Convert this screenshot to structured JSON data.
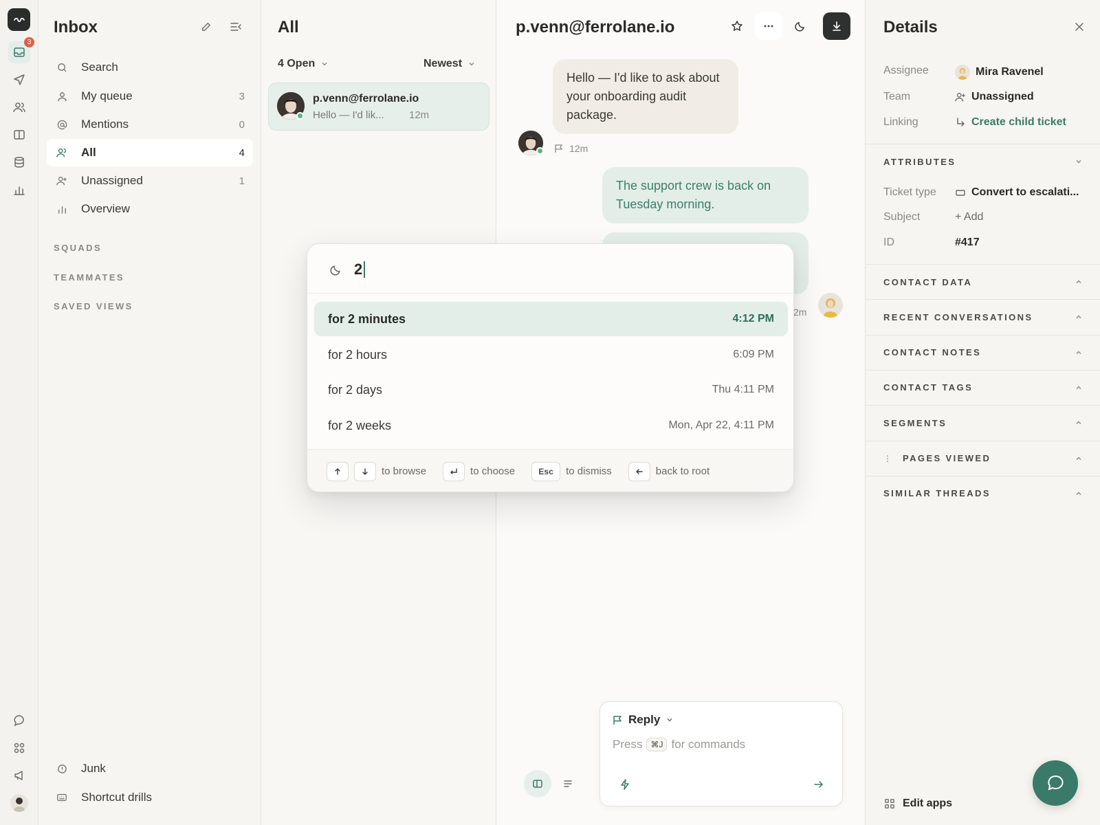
{
  "rail": {
    "inbox_badge": "3"
  },
  "nav": {
    "title": "Inbox",
    "items": [
      {
        "label": "Search",
        "count": ""
      },
      {
        "label": "My queue",
        "count": "3"
      },
      {
        "label": "Mentions",
        "count": "0"
      },
      {
        "label": "All",
        "count": "4"
      },
      {
        "label": "Unassigned",
        "count": "1"
      },
      {
        "label": "Overview",
        "count": ""
      }
    ],
    "sections": [
      "SQUADS",
      "TEAMMATES",
      "SAVED VIEWS"
    ],
    "bottom": [
      {
        "label": "Junk"
      },
      {
        "label": "Shortcut drills"
      }
    ]
  },
  "list": {
    "title": "All",
    "filter_status": "4 Open",
    "filter_sort": "Newest",
    "conversations": [
      {
        "name": "p.venn@ferrolane.io",
        "preview": "Hello — I'd lik...",
        "time": "12m"
      }
    ]
  },
  "conversation": {
    "title": "p.venn@ferrolane.io",
    "messages": [
      {
        "text": "Hello — I'd like to ask about your onboarding audit package.",
        "time": "12m"
      },
      {
        "text": "The support crew is back on Tuesday morning.",
        "time": ""
      },
      {
        "text": "",
        "time": "2m"
      }
    ],
    "reply": {
      "mode": "Reply",
      "placeholder_pre": "Press",
      "shortcut": "⌘J",
      "placeholder_post": "for commands"
    }
  },
  "details": {
    "title": "Details",
    "fields": [
      {
        "label": "Assignee",
        "value": "Mira Ravenel"
      },
      {
        "label": "Team",
        "value": "Unassigned"
      },
      {
        "label": "Linking",
        "value": "Create child ticket"
      }
    ],
    "attributes_title": "ATTRIBUTES",
    "attributes": [
      {
        "label": "Ticket type",
        "value": "Convert to escalati..."
      },
      {
        "label": "Subject",
        "value": "+ Add"
      },
      {
        "label": "ID",
        "value": "#417"
      }
    ],
    "sections": [
      "CONTACT DATA",
      "RECENT CONVERSATIONS",
      "CONTACT NOTES",
      "CONTACT TAGS",
      "SEGMENTS",
      "PAGES VIEWED",
      "SIMILAR THREADS"
    ],
    "edit_apps": "Edit apps"
  },
  "snooze": {
    "query": "2",
    "options": [
      {
        "label": "for 2 minutes",
        "time": "4:12 PM"
      },
      {
        "label": "for 2 hours",
        "time": "6:09 PM"
      },
      {
        "label": "for 2 days",
        "time": "Thu 4:11 PM"
      },
      {
        "label": "for 2 weeks",
        "time": "Mon, Apr 22, 4:11 PM"
      }
    ],
    "hints": {
      "browse": "to browse",
      "choose": "to choose",
      "esc_key": "Esc",
      "dismiss": "to dismiss",
      "root": "back to root"
    }
  },
  "colors": {
    "accent": "#3a7a68",
    "selection": "#e3eee9",
    "badge": "#d9624b"
  }
}
